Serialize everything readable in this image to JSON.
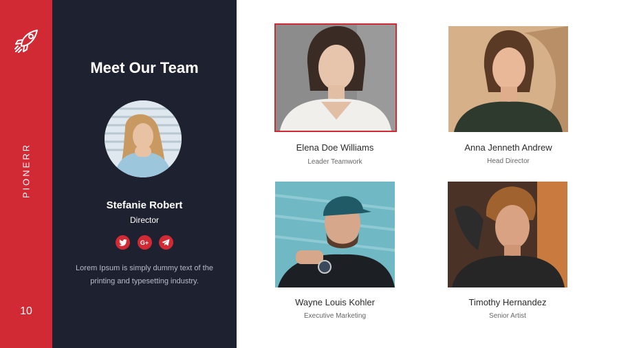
{
  "sidebar": {
    "brand": "PIONERR",
    "page_number": "10",
    "logo_icon": "rocket-icon"
  },
  "panel": {
    "title": "Meet Our Team",
    "leader": {
      "name": "Stefanie  Robert",
      "role": "Director"
    },
    "socials": [
      {
        "icon": "twitter-icon",
        "label": ""
      },
      {
        "icon": "google-plus-icon",
        "label": "G+"
      },
      {
        "icon": "telegram-icon",
        "label": ""
      }
    ],
    "description": "Lorem Ipsum is simply dummy text of the printing and typesetting industry."
  },
  "team": [
    {
      "name": "Elena Doe Williams",
      "role": "Leader  Teamwork"
    },
    {
      "name": "Anna Jenneth Andrew",
      "role": "Head Director"
    },
    {
      "name": "Wayne Louis Kohler",
      "role": "Executive  Marketing"
    },
    {
      "name": "Timothy Hernandez",
      "role": "Senior  Artist"
    }
  ],
  "colors": {
    "accent": "#d12a35",
    "panel": "#1e2130",
    "background": "#ffffff"
  }
}
